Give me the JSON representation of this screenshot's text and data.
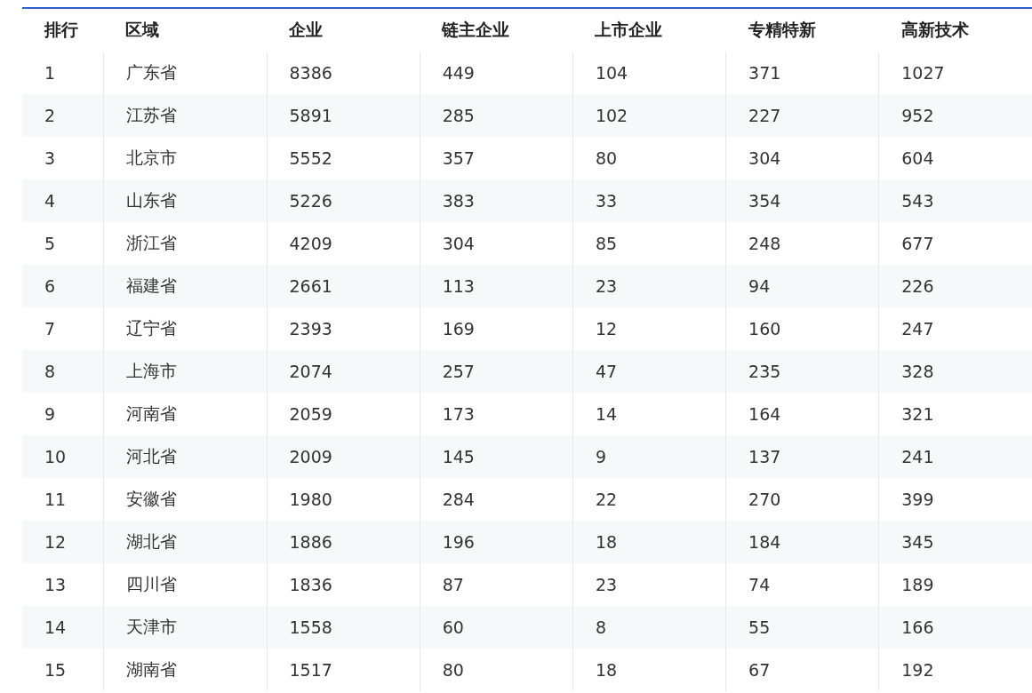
{
  "table": {
    "columns": [
      "排行",
      "区域",
      "企业",
      "链主企业",
      "上市企业",
      "专精特新",
      "高新技术"
    ],
    "rows": [
      [
        "1",
        "广东省",
        "8386",
        "449",
        "104",
        "371",
        "1027"
      ],
      [
        "2",
        "江苏省",
        "5891",
        "285",
        "102",
        "227",
        "952"
      ],
      [
        "3",
        "北京市",
        "5552",
        "357",
        "80",
        "304",
        "604"
      ],
      [
        "4",
        "山东省",
        "5226",
        "383",
        "33",
        "354",
        "543"
      ],
      [
        "5",
        "浙江省",
        "4209",
        "304",
        "85",
        "248",
        "677"
      ],
      [
        "6",
        "福建省",
        "2661",
        "113",
        "23",
        "94",
        "226"
      ],
      [
        "7",
        "辽宁省",
        "2393",
        "169",
        "12",
        "160",
        "247"
      ],
      [
        "8",
        "上海市",
        "2074",
        "257",
        "47",
        "235",
        "328"
      ],
      [
        "9",
        "河南省",
        "2059",
        "173",
        "14",
        "164",
        "321"
      ],
      [
        "10",
        "河北省",
        "2009",
        "145",
        "9",
        "137",
        "241"
      ],
      [
        "11",
        "安徽省",
        "1980",
        "284",
        "22",
        "270",
        "399"
      ],
      [
        "12",
        "湖北省",
        "1886",
        "196",
        "18",
        "184",
        "345"
      ],
      [
        "13",
        "四川省",
        "1836",
        "87",
        "23",
        "74",
        "189"
      ],
      [
        "14",
        "天津市",
        "1558",
        "60",
        "8",
        "55",
        "166"
      ],
      [
        "15",
        "湖南省",
        "1517",
        "80",
        "18",
        "67",
        "192"
      ]
    ]
  }
}
